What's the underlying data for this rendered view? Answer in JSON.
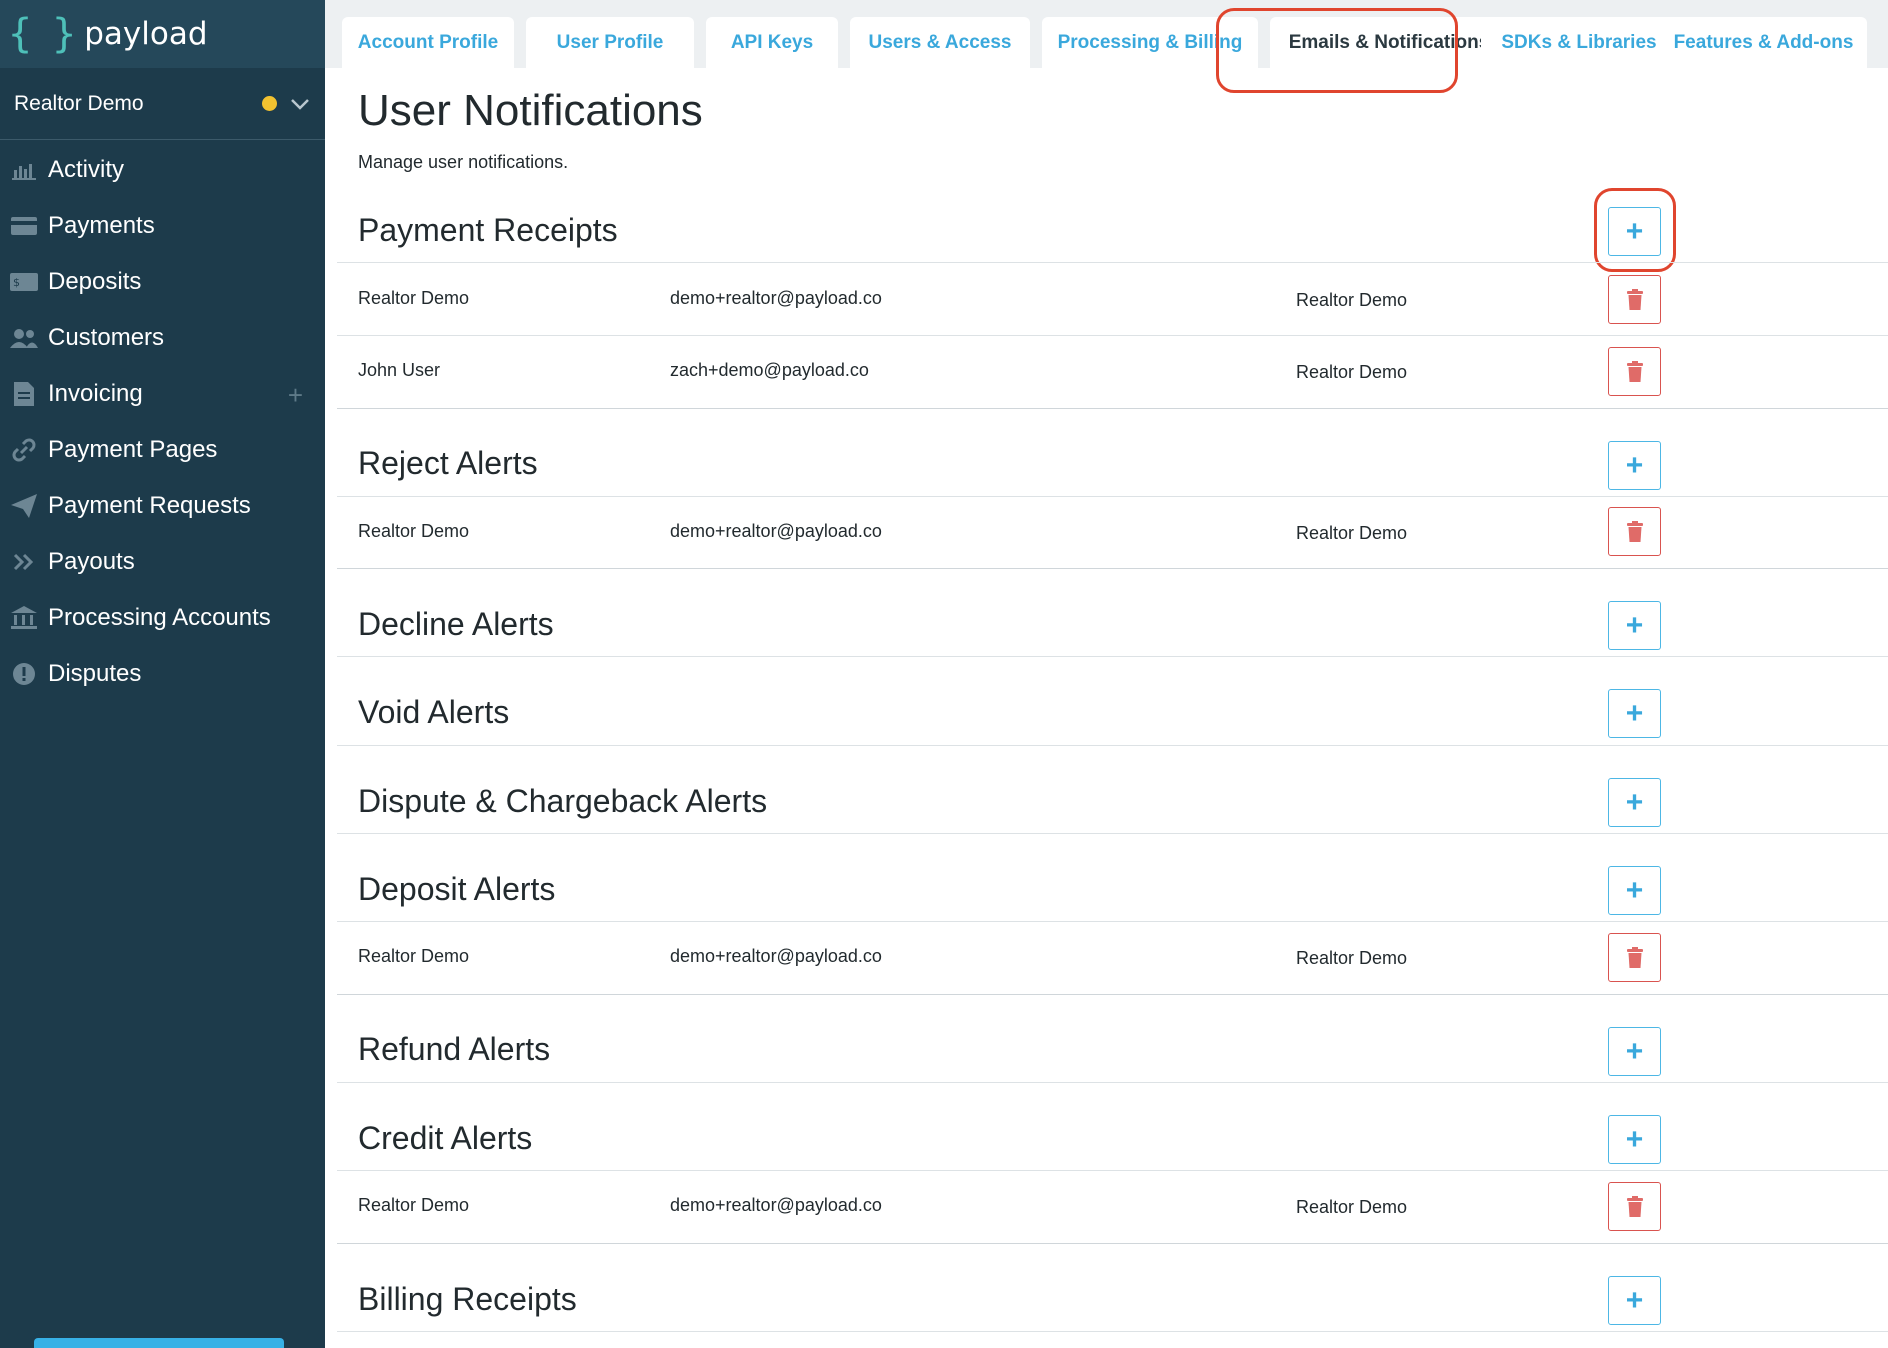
{
  "brand": {
    "logo_text": "payload",
    "logo_brace": "{ }"
  },
  "account": {
    "name": "Realtor Demo",
    "status_color": "#f2c230"
  },
  "sidebar": {
    "items": [
      {
        "label": "Activity",
        "icon": "bar-chart-icon"
      },
      {
        "label": "Payments",
        "icon": "credit-card-icon"
      },
      {
        "label": "Deposits",
        "icon": "cash-icon"
      },
      {
        "label": "Customers",
        "icon": "users-icon"
      },
      {
        "label": "Invoicing",
        "icon": "document-icon",
        "has_add": true
      },
      {
        "label": "Payment Pages",
        "icon": "link-icon"
      },
      {
        "label": "Payment Requests",
        "icon": "paper-plane-icon"
      },
      {
        "label": "Payouts",
        "icon": "double-chevron-right-icon"
      },
      {
        "label": "Processing Accounts",
        "icon": "bank-icon"
      },
      {
        "label": "Disputes",
        "icon": "alert-circle-icon"
      }
    ]
  },
  "tabs": [
    {
      "label": "Account Profile"
    },
    {
      "label": "User Profile"
    },
    {
      "label": "API Keys"
    },
    {
      "label": "Users & Access"
    },
    {
      "label": "Processing & Billing"
    },
    {
      "label": "Emails & Notifications",
      "active": true
    },
    {
      "label": "SDKs & Libraries"
    },
    {
      "label": "Features & Add-ons"
    }
  ],
  "page": {
    "title": "User Notifications",
    "subtitle": "Manage user notifications."
  },
  "sections": [
    {
      "title": "Payment Receipts",
      "rows": [
        {
          "name": "Realtor Demo",
          "email": "demo+realtor@payload.co",
          "account": "Realtor Demo"
        },
        {
          "name": "John User",
          "email": "zach+demo@payload.co",
          "account": "Realtor Demo"
        }
      ]
    },
    {
      "title": "Reject Alerts",
      "rows": [
        {
          "name": "Realtor Demo",
          "email": "demo+realtor@payload.co",
          "account": "Realtor Demo"
        }
      ]
    },
    {
      "title": "Decline Alerts",
      "rows": []
    },
    {
      "title": "Void Alerts",
      "rows": []
    },
    {
      "title": "Dispute & Chargeback Alerts",
      "rows": []
    },
    {
      "title": "Deposit Alerts",
      "rows": [
        {
          "name": "Realtor Demo",
          "email": "demo+realtor@payload.co",
          "account": "Realtor Demo"
        }
      ]
    },
    {
      "title": "Refund Alerts",
      "rows": []
    },
    {
      "title": "Credit Alerts",
      "rows": [
        {
          "name": "Realtor Demo",
          "email": "demo+realtor@payload.co",
          "account": "Realtor Demo"
        }
      ]
    },
    {
      "title": "Billing Receipts",
      "rows": []
    }
  ],
  "buttons": {
    "add_symbol": "+"
  },
  "colors": {
    "accent": "#3aa8dc",
    "danger": "#d9534f",
    "highlight": "#e0452e",
    "sidebar": "#1d3b4b"
  }
}
